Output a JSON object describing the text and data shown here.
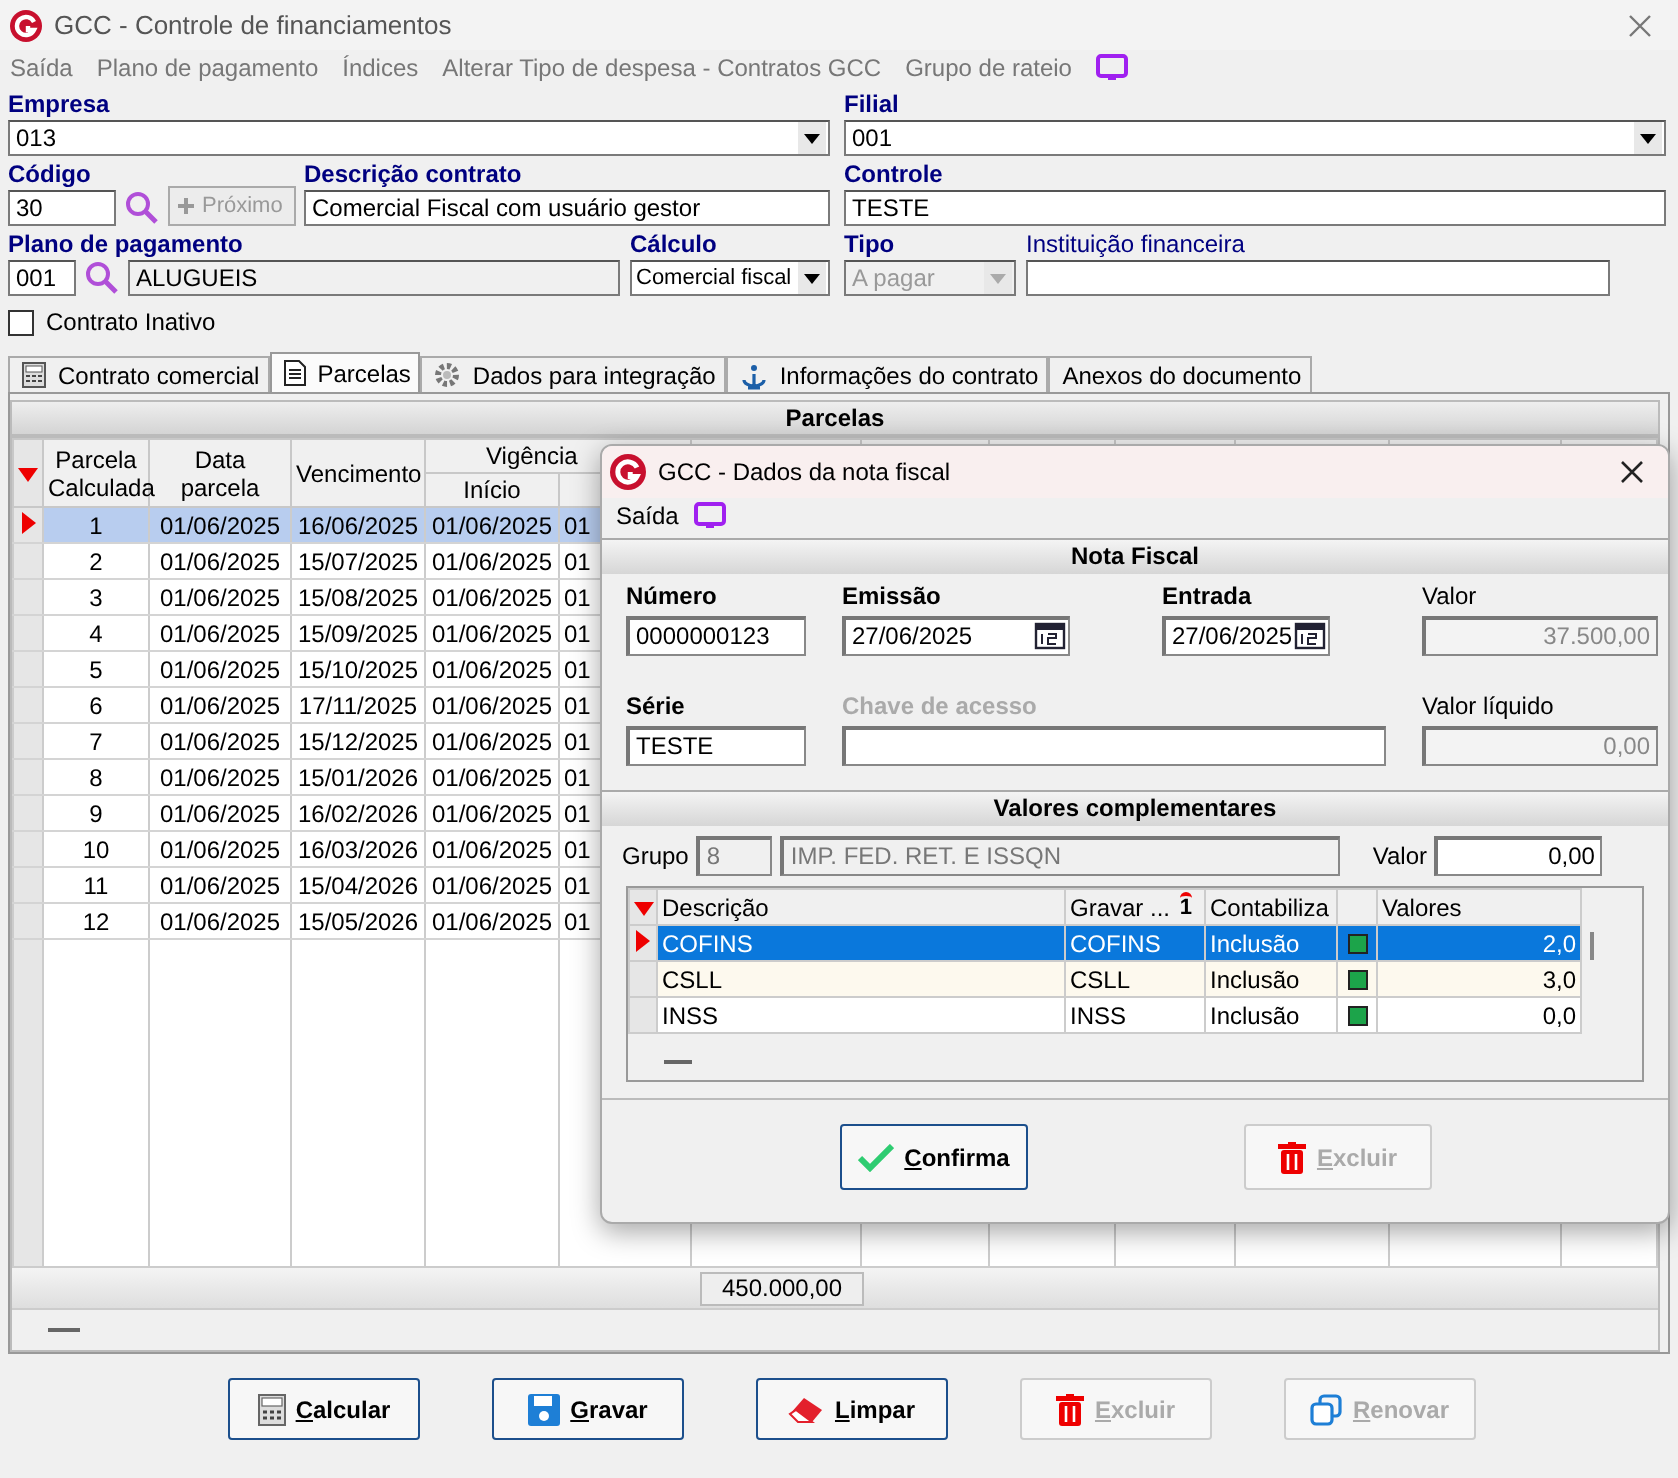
{
  "window": {
    "title": "GCC - Controle de financiamentos"
  },
  "menu": [
    "Saída",
    "Plano de pagamento",
    "Índices",
    "Alterar Tipo de despesa - Contratos GCC",
    "Grupo de rateio"
  ],
  "form": {
    "empresa": {
      "label": "Empresa",
      "value": "013"
    },
    "filial": {
      "label": "Filial",
      "value": "001"
    },
    "codigo": {
      "label": "Código",
      "value": "30"
    },
    "proximo": {
      "label": "Próximo",
      "disabled": true
    },
    "descricao": {
      "label": "Descrição contrato",
      "value": "Comercial Fiscal com usuário gestor"
    },
    "controle": {
      "label": "Controle",
      "value": "TESTE"
    },
    "plano": {
      "label": "Plano de pagamento",
      "code": "001",
      "name": "ALUGUEIS"
    },
    "calculo": {
      "label": "Cálculo",
      "value": "Comercial fiscal"
    },
    "tipo": {
      "label": "Tipo",
      "value": "A pagar",
      "disabled": true
    },
    "instituicao": {
      "label": "Instituição financeira"
    },
    "inativo": {
      "label": "Contrato Inativo",
      "checked": false
    }
  },
  "tabs": [
    {
      "label": "Contrato comercial",
      "selected": false
    },
    {
      "label": "Parcelas",
      "selected": true
    },
    {
      "label": "Dados para integração",
      "selected": false
    },
    {
      "label": "Informações do contrato",
      "selected": false
    },
    {
      "label": "Anexos do documento",
      "selected": false
    }
  ],
  "parcelas": {
    "title": "Parcelas",
    "group_header": "Vigência",
    "columns": [
      "Parcela Calculada",
      "Data parcela",
      "Vencimento",
      "Início"
    ],
    "rows": [
      {
        "cells": [
          "1",
          "01/06/2025",
          "16/06/2025",
          "01/06/2025",
          "01"
        ],
        "selected": true
      },
      {
        "cells": [
          "2",
          "01/06/2025",
          "15/07/2025",
          "01/06/2025",
          "01"
        ],
        "selected": false
      },
      {
        "cells": [
          "3",
          "01/06/2025",
          "15/08/2025",
          "01/06/2025",
          "01"
        ],
        "selected": false
      },
      {
        "cells": [
          "4",
          "01/06/2025",
          "15/09/2025",
          "01/06/2025",
          "01"
        ],
        "selected": false
      },
      {
        "cells": [
          "5",
          "01/06/2025",
          "15/10/2025",
          "01/06/2025",
          "01"
        ],
        "selected": false
      },
      {
        "cells": [
          "6",
          "01/06/2025",
          "17/11/2025",
          "01/06/2025",
          "01"
        ],
        "selected": false
      },
      {
        "cells": [
          "7",
          "01/06/2025",
          "15/12/2025",
          "01/06/2025",
          "01"
        ],
        "selected": false
      },
      {
        "cells": [
          "8",
          "01/06/2025",
          "15/01/2026",
          "01/06/2025",
          "01"
        ],
        "selected": false
      },
      {
        "cells": [
          "9",
          "01/06/2025",
          "16/02/2026",
          "01/06/2025",
          "01"
        ],
        "selected": false
      },
      {
        "cells": [
          "10",
          "01/06/2025",
          "16/03/2026",
          "01/06/2025",
          "01"
        ],
        "selected": false
      },
      {
        "cells": [
          "11",
          "01/06/2025",
          "15/04/2026",
          "01/06/2025",
          "01"
        ],
        "selected": false
      },
      {
        "cells": [
          "12",
          "01/06/2025",
          "15/05/2026",
          "01/06/2025",
          "01"
        ],
        "selected": false
      }
    ],
    "total": "450.000,00"
  },
  "buttons": [
    {
      "label": "Calcular",
      "kind": "calc",
      "disabled": false
    },
    {
      "label": "Gravar",
      "kind": "save",
      "disabled": false
    },
    {
      "label": "Limpar",
      "kind": "clear",
      "disabled": false
    },
    {
      "label": "Excluir",
      "kind": "delete",
      "disabled": true
    },
    {
      "label": "Renovar",
      "kind": "copy",
      "disabled": true
    }
  ],
  "dialog": {
    "title": "GCC - Dados da nota fiscal",
    "menu": [
      "Saída"
    ],
    "section": "Nota Fiscal",
    "fields": [
      {
        "label": "Número",
        "value": "0000000123",
        "kind": "text",
        "disabled": false
      },
      {
        "label": "Emissão",
        "value": "27/06/2025",
        "kind": "date",
        "disabled": false
      },
      {
        "label": "Entrada",
        "value": "27/06/2025",
        "kind": "date",
        "disabled": false
      },
      {
        "label": "Valor",
        "value": "37.500,00",
        "kind": "amount",
        "disabled": false
      },
      {
        "label": "Série",
        "value": "TESTE",
        "kind": "text",
        "disabled": false
      },
      {
        "label": "Chave de acesso",
        "kind": "wide",
        "disabled": true
      },
      {
        "label": "Valor líquido",
        "value": "0,00",
        "kind": "amount",
        "disabled": false
      }
    ],
    "complement": {
      "title": "Valores complementares",
      "grupo_label": "Grupo",
      "grupo_code": "8",
      "grupo_name": "IMP. FED. RET. E ISSQN",
      "valor_label": "Valor",
      "valor": "0,00",
      "columns": [
        "Descrição",
        "Gravar ...",
        "Contabiliza",
        "Valores"
      ],
      "sort_mark": "1",
      "rows": [
        {
          "descricao": "COFINS",
          "gravar": "COFINS",
          "contabiliza": "Inclusão",
          "checked": true,
          "valor": "2,0",
          "selected": true
        },
        {
          "descricao": "CSLL",
          "gravar": "CSLL",
          "contabiliza": "Inclusão",
          "checked": true,
          "valor": "3,0",
          "selected": false
        },
        {
          "descricao": "INSS",
          "gravar": "INSS",
          "contabiliza": "Inclusão",
          "checked": true,
          "valor": "0,0",
          "selected": false
        }
      ]
    },
    "buttons": [
      {
        "label": "Confirma",
        "kind": "confirm",
        "disabled": false
      },
      {
        "label": "Excluir",
        "kind": "delete",
        "disabled": true
      }
    ]
  }
}
